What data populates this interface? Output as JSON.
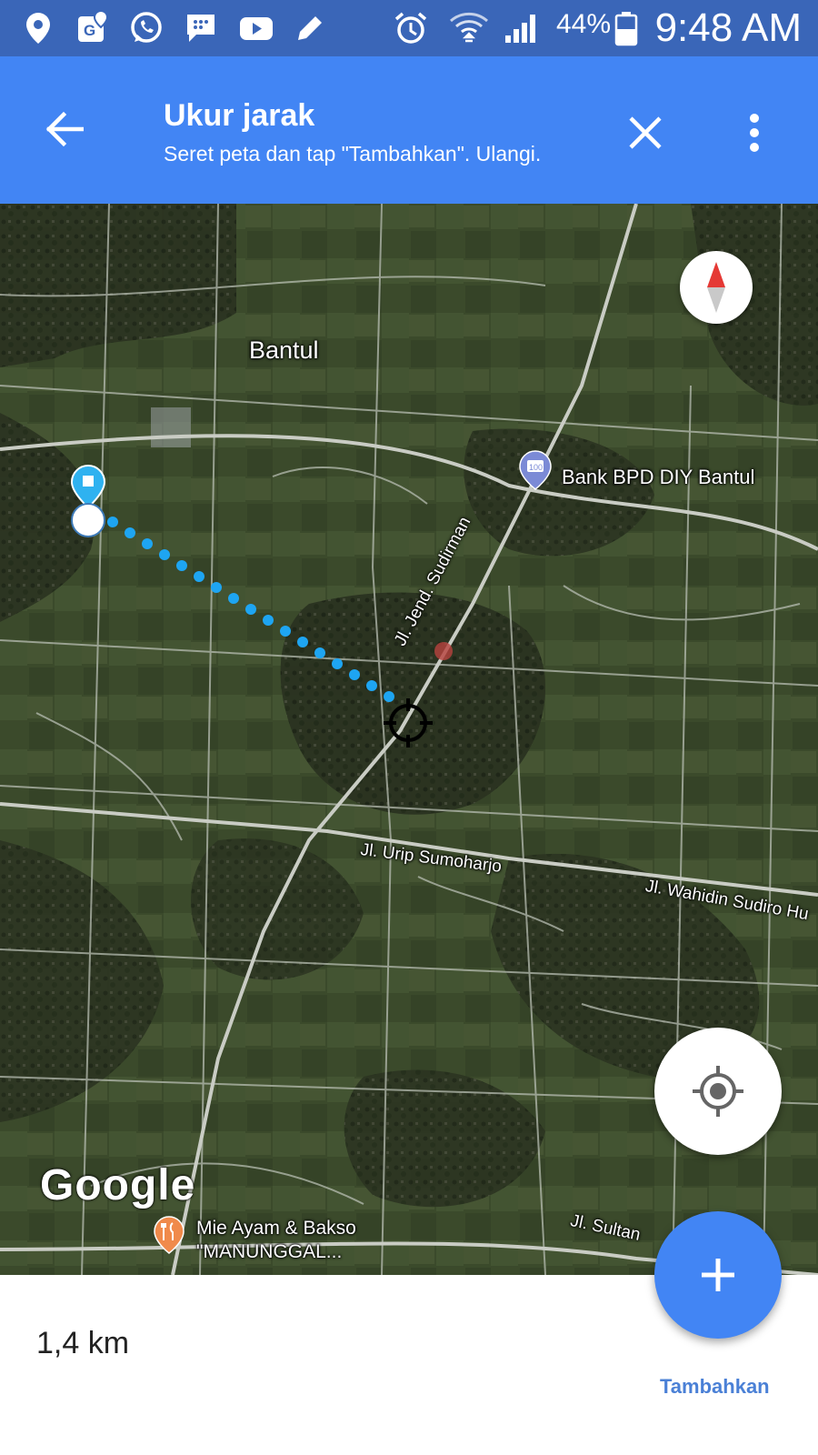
{
  "status_bar": {
    "icons": [
      "location-icon",
      "maps-notification-icon",
      "whatsapp-icon",
      "messenger-icon",
      "youtube-icon",
      "edit-icon"
    ],
    "right_icons": [
      "alarm-icon",
      "wifi-icon",
      "signal-icon",
      "battery-icon"
    ],
    "battery_text": "44%",
    "time": "9:48 AM",
    "background": "#3a66b8"
  },
  "app_bar": {
    "title": "Ukur jarak",
    "subtitle": "Seret peta dan tap \"Tambahkan\". Ulangi.",
    "background": "#4285f4"
  },
  "map": {
    "labels": {
      "bantul": "Bantul",
      "bank": "Bank BPD DIY Bantul",
      "sudirman": "Jl. Jend. Sudirman",
      "urip": "Jl. Urip Sumoharjo",
      "wahidin": "Jl. Wahidin Sudiro Hu",
      "sultan": "Jl. Sultan",
      "mie_line1": "Mie Ayam & Bakso",
      "mie_line2": "\"MANUNGGAL..."
    },
    "google_logo": "Google",
    "route_color": "#1ea5f2"
  },
  "bottom": {
    "distance": "1,4 km",
    "add_label": "Tambahkan",
    "accent": "#4285f4"
  }
}
